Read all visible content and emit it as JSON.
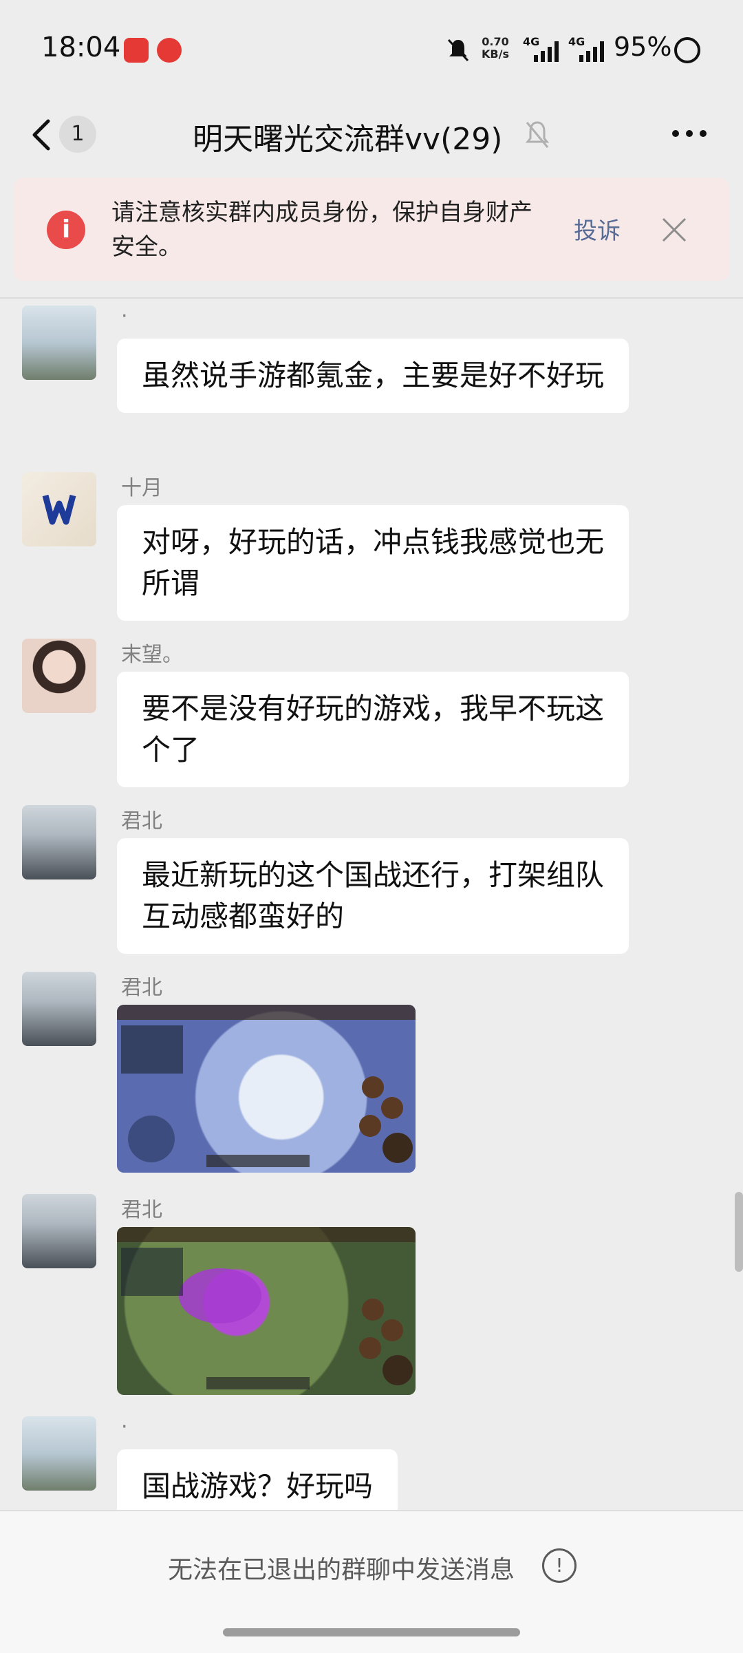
{
  "status_bar": {
    "time": "18:04",
    "net_speed_value": "0.70",
    "net_speed_unit": "KB/s",
    "signal1": "4G",
    "signal2": "4G",
    "battery": "95%"
  },
  "header": {
    "unread_count": "1",
    "title": "明天曙光交流群vv(29)"
  },
  "banner": {
    "icon_text": "i",
    "text": "请注意核实群内成员身份，保护自身财产安全。",
    "complain_label": "投诉"
  },
  "messages": [
    {
      "sender": "·",
      "text": "虽然说手游都氪金，主要是好不好玩"
    },
    {
      "sender": "十月",
      "text": "对呀，好玩的话，冲点钱我感觉也无所谓"
    },
    {
      "sender": "末望。",
      "text": "要不是没有好玩的游戏，我早不玩这个了"
    },
    {
      "sender": "君北",
      "text": "最近新玩的这个国战还行，打架组队互动感都蛮好的"
    },
    {
      "sender": "君北",
      "image": "game-screenshot-1"
    },
    {
      "sender": "君北",
      "image": "game-screenshot-2"
    },
    {
      "sender": "·",
      "text": "国战游戏？好玩吗"
    }
  ],
  "footer": {
    "text": "无法在已退出的群聊中发送消息",
    "info_icon_text": "!"
  },
  "colors": {
    "background": "#ededed",
    "banner_bg": "#f8e9e9",
    "alert_red": "#e94a4a",
    "link_blue": "#576b95"
  }
}
